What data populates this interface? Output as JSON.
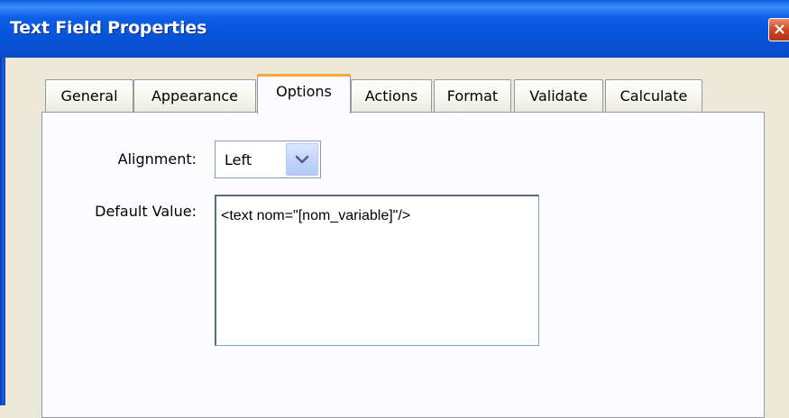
{
  "window": {
    "title": "Text Field Properties",
    "close_icon": "×"
  },
  "tabs": [
    {
      "label": "General",
      "active": false
    },
    {
      "label": "Appearance",
      "active": false
    },
    {
      "label": "Options",
      "active": true
    },
    {
      "label": "Actions",
      "active": false
    },
    {
      "label": "Format",
      "active": false
    },
    {
      "label": "Validate",
      "active": false
    },
    {
      "label": "Calculate",
      "active": false
    }
  ],
  "options": {
    "alignment_label": "Alignment:",
    "alignment_value": "Left",
    "default_value_label": "Default Value:",
    "default_value": "<text nom=\"[nom_variable]\"/>"
  },
  "colors": {
    "titlebar": "#0651d6",
    "active_tab_accent": "#f8a53a",
    "dialog_bg": "#ece9d8",
    "panel_bg": "#fcfcfe"
  }
}
